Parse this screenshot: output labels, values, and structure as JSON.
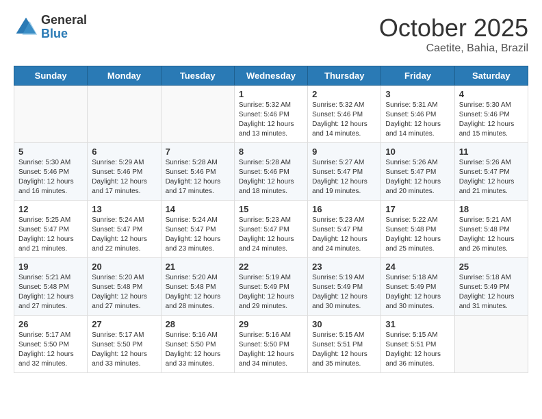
{
  "header": {
    "logo_general": "General",
    "logo_blue": "Blue",
    "month_title": "October 2025",
    "location": "Caetite, Bahia, Brazil"
  },
  "weekdays": [
    "Sunday",
    "Monday",
    "Tuesday",
    "Wednesday",
    "Thursday",
    "Friday",
    "Saturday"
  ],
  "weeks": [
    [
      {
        "day": "",
        "info": ""
      },
      {
        "day": "",
        "info": ""
      },
      {
        "day": "",
        "info": ""
      },
      {
        "day": "1",
        "info": "Sunrise: 5:32 AM\nSunset: 5:46 PM\nDaylight: 12 hours\nand 13 minutes."
      },
      {
        "day": "2",
        "info": "Sunrise: 5:32 AM\nSunset: 5:46 PM\nDaylight: 12 hours\nand 14 minutes."
      },
      {
        "day": "3",
        "info": "Sunrise: 5:31 AM\nSunset: 5:46 PM\nDaylight: 12 hours\nand 14 minutes."
      },
      {
        "day": "4",
        "info": "Sunrise: 5:30 AM\nSunset: 5:46 PM\nDaylight: 12 hours\nand 15 minutes."
      }
    ],
    [
      {
        "day": "5",
        "info": "Sunrise: 5:30 AM\nSunset: 5:46 PM\nDaylight: 12 hours\nand 16 minutes."
      },
      {
        "day": "6",
        "info": "Sunrise: 5:29 AM\nSunset: 5:46 PM\nDaylight: 12 hours\nand 17 minutes."
      },
      {
        "day": "7",
        "info": "Sunrise: 5:28 AM\nSunset: 5:46 PM\nDaylight: 12 hours\nand 17 minutes."
      },
      {
        "day": "8",
        "info": "Sunrise: 5:28 AM\nSunset: 5:46 PM\nDaylight: 12 hours\nand 18 minutes."
      },
      {
        "day": "9",
        "info": "Sunrise: 5:27 AM\nSunset: 5:47 PM\nDaylight: 12 hours\nand 19 minutes."
      },
      {
        "day": "10",
        "info": "Sunrise: 5:26 AM\nSunset: 5:47 PM\nDaylight: 12 hours\nand 20 minutes."
      },
      {
        "day": "11",
        "info": "Sunrise: 5:26 AM\nSunset: 5:47 PM\nDaylight: 12 hours\nand 21 minutes."
      }
    ],
    [
      {
        "day": "12",
        "info": "Sunrise: 5:25 AM\nSunset: 5:47 PM\nDaylight: 12 hours\nand 21 minutes."
      },
      {
        "day": "13",
        "info": "Sunrise: 5:24 AM\nSunset: 5:47 PM\nDaylight: 12 hours\nand 22 minutes."
      },
      {
        "day": "14",
        "info": "Sunrise: 5:24 AM\nSunset: 5:47 PM\nDaylight: 12 hours\nand 23 minutes."
      },
      {
        "day": "15",
        "info": "Sunrise: 5:23 AM\nSunset: 5:47 PM\nDaylight: 12 hours\nand 24 minutes."
      },
      {
        "day": "16",
        "info": "Sunrise: 5:23 AM\nSunset: 5:47 PM\nDaylight: 12 hours\nand 24 minutes."
      },
      {
        "day": "17",
        "info": "Sunrise: 5:22 AM\nSunset: 5:48 PM\nDaylight: 12 hours\nand 25 minutes."
      },
      {
        "day": "18",
        "info": "Sunrise: 5:21 AM\nSunset: 5:48 PM\nDaylight: 12 hours\nand 26 minutes."
      }
    ],
    [
      {
        "day": "19",
        "info": "Sunrise: 5:21 AM\nSunset: 5:48 PM\nDaylight: 12 hours\nand 27 minutes."
      },
      {
        "day": "20",
        "info": "Sunrise: 5:20 AM\nSunset: 5:48 PM\nDaylight: 12 hours\nand 27 minutes."
      },
      {
        "day": "21",
        "info": "Sunrise: 5:20 AM\nSunset: 5:48 PM\nDaylight: 12 hours\nand 28 minutes."
      },
      {
        "day": "22",
        "info": "Sunrise: 5:19 AM\nSunset: 5:49 PM\nDaylight: 12 hours\nand 29 minutes."
      },
      {
        "day": "23",
        "info": "Sunrise: 5:19 AM\nSunset: 5:49 PM\nDaylight: 12 hours\nand 30 minutes."
      },
      {
        "day": "24",
        "info": "Sunrise: 5:18 AM\nSunset: 5:49 PM\nDaylight: 12 hours\nand 30 minutes."
      },
      {
        "day": "25",
        "info": "Sunrise: 5:18 AM\nSunset: 5:49 PM\nDaylight: 12 hours\nand 31 minutes."
      }
    ],
    [
      {
        "day": "26",
        "info": "Sunrise: 5:17 AM\nSunset: 5:50 PM\nDaylight: 12 hours\nand 32 minutes."
      },
      {
        "day": "27",
        "info": "Sunrise: 5:17 AM\nSunset: 5:50 PM\nDaylight: 12 hours\nand 33 minutes."
      },
      {
        "day": "28",
        "info": "Sunrise: 5:16 AM\nSunset: 5:50 PM\nDaylight: 12 hours\nand 33 minutes."
      },
      {
        "day": "29",
        "info": "Sunrise: 5:16 AM\nSunset: 5:50 PM\nDaylight: 12 hours\nand 34 minutes."
      },
      {
        "day": "30",
        "info": "Sunrise: 5:15 AM\nSunset: 5:51 PM\nDaylight: 12 hours\nand 35 minutes."
      },
      {
        "day": "31",
        "info": "Sunrise: 5:15 AM\nSunset: 5:51 PM\nDaylight: 12 hours\nand 36 minutes."
      },
      {
        "day": "",
        "info": ""
      }
    ]
  ]
}
